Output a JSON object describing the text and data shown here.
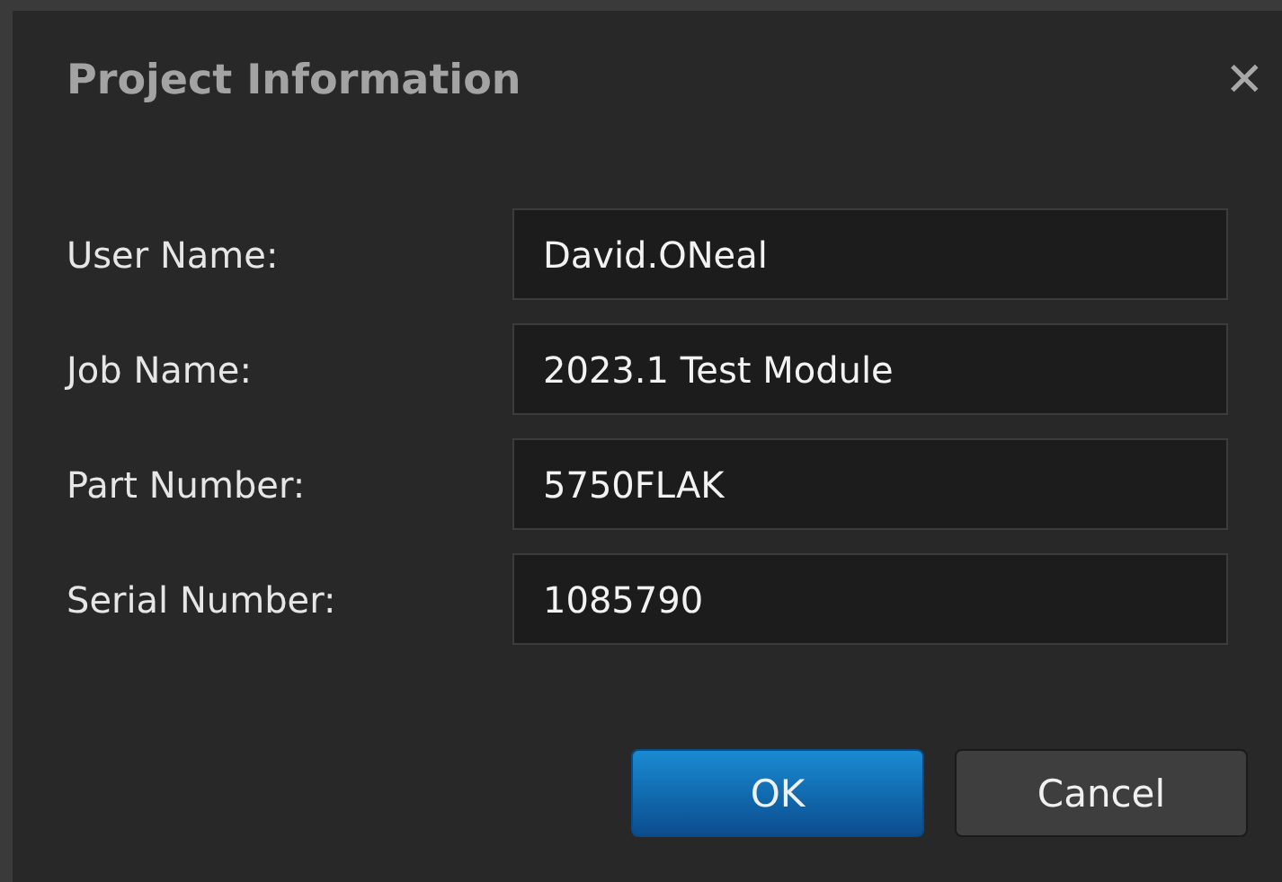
{
  "window": {
    "title": "Project Information",
    "close": "✕"
  },
  "fields": [
    {
      "label": "User Name:",
      "value": "David.ONeal"
    },
    {
      "label": "Job Name:",
      "value": "2023.1 Test Module"
    },
    {
      "label": "Part Number:",
      "value": "5750FLAK"
    },
    {
      "label": "Serial Number:",
      "value": "1085790"
    }
  ],
  "buttons": [
    {
      "label": "OK",
      "default": true
    },
    {
      "label": "Cancel",
      "default": false
    }
  ]
}
